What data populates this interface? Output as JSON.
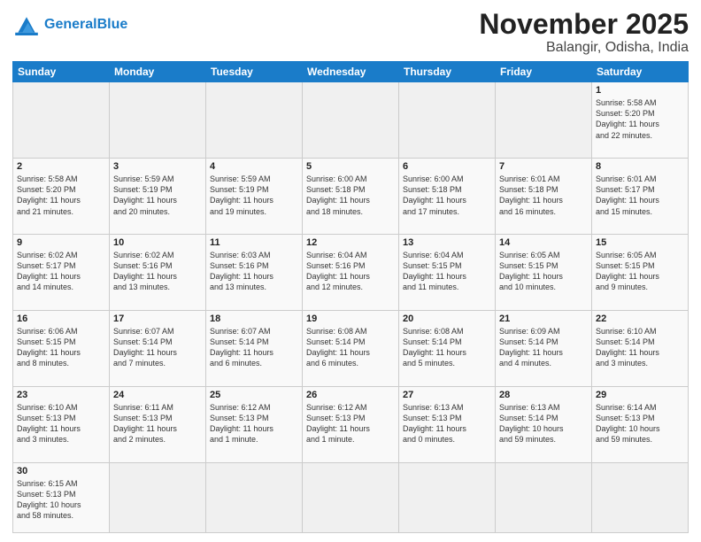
{
  "header": {
    "title": "November 2025",
    "subtitle": "Balangir, Odisha, India",
    "logo_general": "General",
    "logo_blue": "Blue"
  },
  "weekdays": [
    "Sunday",
    "Monday",
    "Tuesday",
    "Wednesday",
    "Thursday",
    "Friday",
    "Saturday"
  ],
  "weeks": [
    [
      {
        "day": "",
        "info": ""
      },
      {
        "day": "",
        "info": ""
      },
      {
        "day": "",
        "info": ""
      },
      {
        "day": "",
        "info": ""
      },
      {
        "day": "",
        "info": ""
      },
      {
        "day": "",
        "info": ""
      },
      {
        "day": "1",
        "info": "Sunrise: 5:58 AM\nSunset: 5:20 PM\nDaylight: 11 hours\nand 22 minutes."
      }
    ],
    [
      {
        "day": "2",
        "info": "Sunrise: 5:58 AM\nSunset: 5:20 PM\nDaylight: 11 hours\nand 21 minutes."
      },
      {
        "day": "3",
        "info": "Sunrise: 5:59 AM\nSunset: 5:19 PM\nDaylight: 11 hours\nand 20 minutes."
      },
      {
        "day": "4",
        "info": "Sunrise: 5:59 AM\nSunset: 5:19 PM\nDaylight: 11 hours\nand 19 minutes."
      },
      {
        "day": "5",
        "info": "Sunrise: 6:00 AM\nSunset: 5:18 PM\nDaylight: 11 hours\nand 18 minutes."
      },
      {
        "day": "6",
        "info": "Sunrise: 6:00 AM\nSunset: 5:18 PM\nDaylight: 11 hours\nand 17 minutes."
      },
      {
        "day": "7",
        "info": "Sunrise: 6:01 AM\nSunset: 5:18 PM\nDaylight: 11 hours\nand 16 minutes."
      },
      {
        "day": "8",
        "info": "Sunrise: 6:01 AM\nSunset: 5:17 PM\nDaylight: 11 hours\nand 15 minutes."
      }
    ],
    [
      {
        "day": "9",
        "info": "Sunrise: 6:02 AM\nSunset: 5:17 PM\nDaylight: 11 hours\nand 14 minutes."
      },
      {
        "day": "10",
        "info": "Sunrise: 6:02 AM\nSunset: 5:16 PM\nDaylight: 11 hours\nand 13 minutes."
      },
      {
        "day": "11",
        "info": "Sunrise: 6:03 AM\nSunset: 5:16 PM\nDaylight: 11 hours\nand 13 minutes."
      },
      {
        "day": "12",
        "info": "Sunrise: 6:04 AM\nSunset: 5:16 PM\nDaylight: 11 hours\nand 12 minutes."
      },
      {
        "day": "13",
        "info": "Sunrise: 6:04 AM\nSunset: 5:15 PM\nDaylight: 11 hours\nand 11 minutes."
      },
      {
        "day": "14",
        "info": "Sunrise: 6:05 AM\nSunset: 5:15 PM\nDaylight: 11 hours\nand 10 minutes."
      },
      {
        "day": "15",
        "info": "Sunrise: 6:05 AM\nSunset: 5:15 PM\nDaylight: 11 hours\nand 9 minutes."
      }
    ],
    [
      {
        "day": "16",
        "info": "Sunrise: 6:06 AM\nSunset: 5:15 PM\nDaylight: 11 hours\nand 8 minutes."
      },
      {
        "day": "17",
        "info": "Sunrise: 6:07 AM\nSunset: 5:14 PM\nDaylight: 11 hours\nand 7 minutes."
      },
      {
        "day": "18",
        "info": "Sunrise: 6:07 AM\nSunset: 5:14 PM\nDaylight: 11 hours\nand 6 minutes."
      },
      {
        "day": "19",
        "info": "Sunrise: 6:08 AM\nSunset: 5:14 PM\nDaylight: 11 hours\nand 6 minutes."
      },
      {
        "day": "20",
        "info": "Sunrise: 6:08 AM\nSunset: 5:14 PM\nDaylight: 11 hours\nand 5 minutes."
      },
      {
        "day": "21",
        "info": "Sunrise: 6:09 AM\nSunset: 5:14 PM\nDaylight: 11 hours\nand 4 minutes."
      },
      {
        "day": "22",
        "info": "Sunrise: 6:10 AM\nSunset: 5:14 PM\nDaylight: 11 hours\nand 3 minutes."
      }
    ],
    [
      {
        "day": "23",
        "info": "Sunrise: 6:10 AM\nSunset: 5:13 PM\nDaylight: 11 hours\nand 3 minutes."
      },
      {
        "day": "24",
        "info": "Sunrise: 6:11 AM\nSunset: 5:13 PM\nDaylight: 11 hours\nand 2 minutes."
      },
      {
        "day": "25",
        "info": "Sunrise: 6:12 AM\nSunset: 5:13 PM\nDaylight: 11 hours\nand 1 minute."
      },
      {
        "day": "26",
        "info": "Sunrise: 6:12 AM\nSunset: 5:13 PM\nDaylight: 11 hours\nand 1 minute."
      },
      {
        "day": "27",
        "info": "Sunrise: 6:13 AM\nSunset: 5:13 PM\nDaylight: 11 hours\nand 0 minutes."
      },
      {
        "day": "28",
        "info": "Sunrise: 6:13 AM\nSunset: 5:14 PM\nDaylight: 10 hours\nand 59 minutes."
      },
      {
        "day": "29",
        "info": "Sunrise: 6:14 AM\nSunset: 5:13 PM\nDaylight: 10 hours\nand 59 minutes."
      }
    ],
    [
      {
        "day": "30",
        "info": "Sunrise: 6:15 AM\nSunset: 5:13 PM\nDaylight: 10 hours\nand 58 minutes."
      },
      {
        "day": "",
        "info": ""
      },
      {
        "day": "",
        "info": ""
      },
      {
        "day": "",
        "info": ""
      },
      {
        "day": "",
        "info": ""
      },
      {
        "day": "",
        "info": ""
      },
      {
        "day": "",
        "info": ""
      }
    ]
  ]
}
